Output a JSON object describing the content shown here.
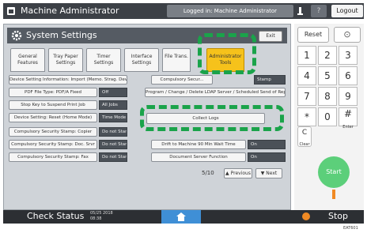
{
  "header": {
    "title": "Machine Administrator",
    "login_status": "Logged in: Machine Administrator",
    "help": "?",
    "logout_label": "Logout"
  },
  "panel": {
    "title": "System Settings",
    "exit_label": "Exit",
    "tabs": [
      "General Features",
      "Tray Paper Settings",
      "Timer Settings",
      "Interface Settings",
      "File Trans.",
      "Administrator Tools"
    ],
    "rows": {
      "r1_left": "Device Setting Information: Import (Memo. Strag. Devc)",
      "r1_mid": "Compulsory Secur...",
      "r1_val": "Stamp",
      "r2_left": "PDF File Type: PDF/A Fixed",
      "r2_left_val": "Off",
      "r2_right": "Program / Change / Delete LDAP Server / Scheduled Send of Report Settings",
      "r3_left": "Stop Key to Suspend Print Job",
      "r3_left_val": "All Jobs",
      "r4_left": "Device Setting: Reset (Home Mode)",
      "r4_left_val": "Time Mode",
      "r4_right": "Collect Logs",
      "r5_left": "Compulsory Security Stamp: Copier",
      "r5_left_val": "Do not Stamp",
      "r6_left": "Compulsory Security Stamp: Doc. Srvr",
      "r6_left_val": "Do not Stamp",
      "r6_right": "Drift to Machine 90 Min Wait Time",
      "r6_right_val": "On",
      "r7_left": "Compulsory Security Stamp: Fax",
      "r7_left_val": "Do not Stamp",
      "r7_right": "Document Server Function",
      "r7_right_val": "On"
    },
    "pager": {
      "text": "5/10",
      "prev": "Previous",
      "next": "Next"
    }
  },
  "keypad": {
    "reset": "Reset",
    "keys": [
      "1",
      "2",
      "3",
      "4",
      "5",
      "6",
      "7",
      "8",
      "9",
      "*",
      "0",
      "#"
    ],
    "enter_sub": "Enter",
    "clear": "C",
    "clear_sub": "Clear",
    "start": "Start"
  },
  "statusbar": {
    "check_status": "Check Status",
    "time_line1": "05/25 2018",
    "time_line2": "08:38",
    "stop": "Stop"
  },
  "caption": "EAT601"
}
